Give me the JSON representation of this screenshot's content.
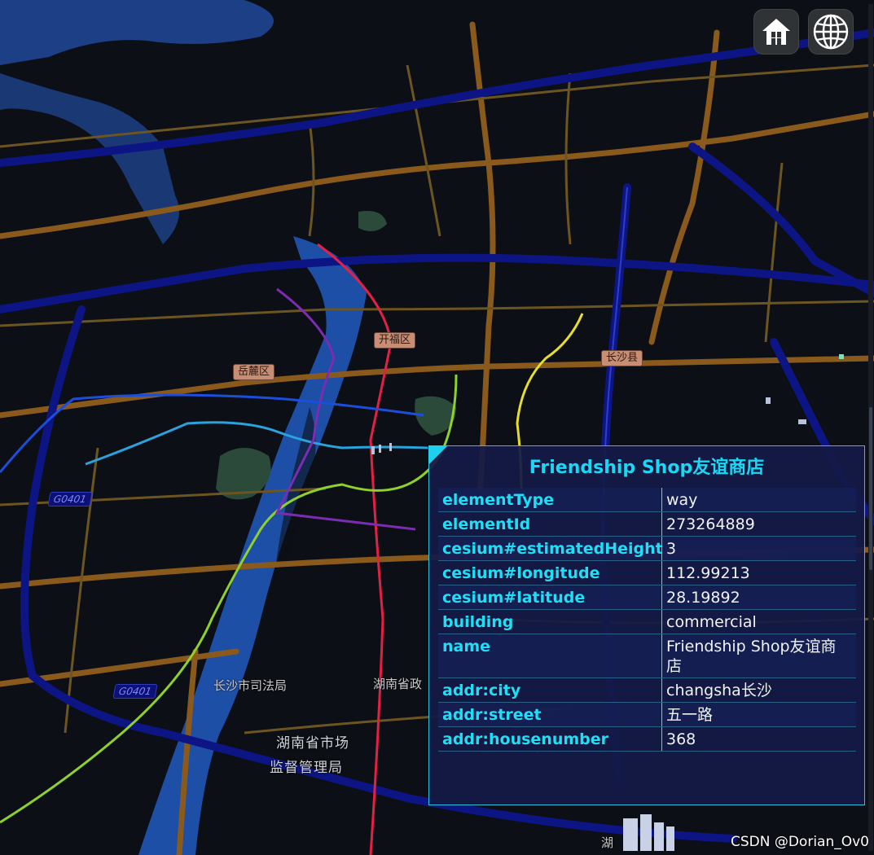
{
  "toolbar": {
    "home_icon": "home-icon",
    "globe_icon": "globe-icon"
  },
  "map": {
    "district_labels": [
      "开福区",
      "岳麓区",
      "长沙县"
    ],
    "road_shields": [
      "G0401",
      "G0401"
    ],
    "place_labels": [
      "长沙市司法局",
      "湖南省政",
      "湖南省市场",
      "监督管理局",
      "湖"
    ]
  },
  "info_box": {
    "title": "Friendship Shop友谊商店",
    "rows": [
      {
        "key": "elementType",
        "value": "way"
      },
      {
        "key": "elementId",
        "value": "273264889"
      },
      {
        "key": "cesium#estimatedHeight",
        "value": "3"
      },
      {
        "key": "cesium#longitude",
        "value": "112.99213"
      },
      {
        "key": "cesium#latitude",
        "value": "28.19892"
      },
      {
        "key": "building",
        "value": "commercial"
      },
      {
        "key": "name",
        "value": "Friendship Shop友谊商店"
      },
      {
        "key": "addr:city",
        "value": "changsha长沙"
      },
      {
        "key": "addr:street",
        "value": "五一路"
      },
      {
        "key": "addr:housenumber",
        "value": "368"
      }
    ]
  },
  "watermark": "CSDN @Dorian_Ov0",
  "colors": {
    "background": "#0c0f15",
    "river": "#1f4fa8",
    "highway": "#0c1480",
    "arterial": "#8a5a1c",
    "info_accent": "#19d8f5"
  }
}
